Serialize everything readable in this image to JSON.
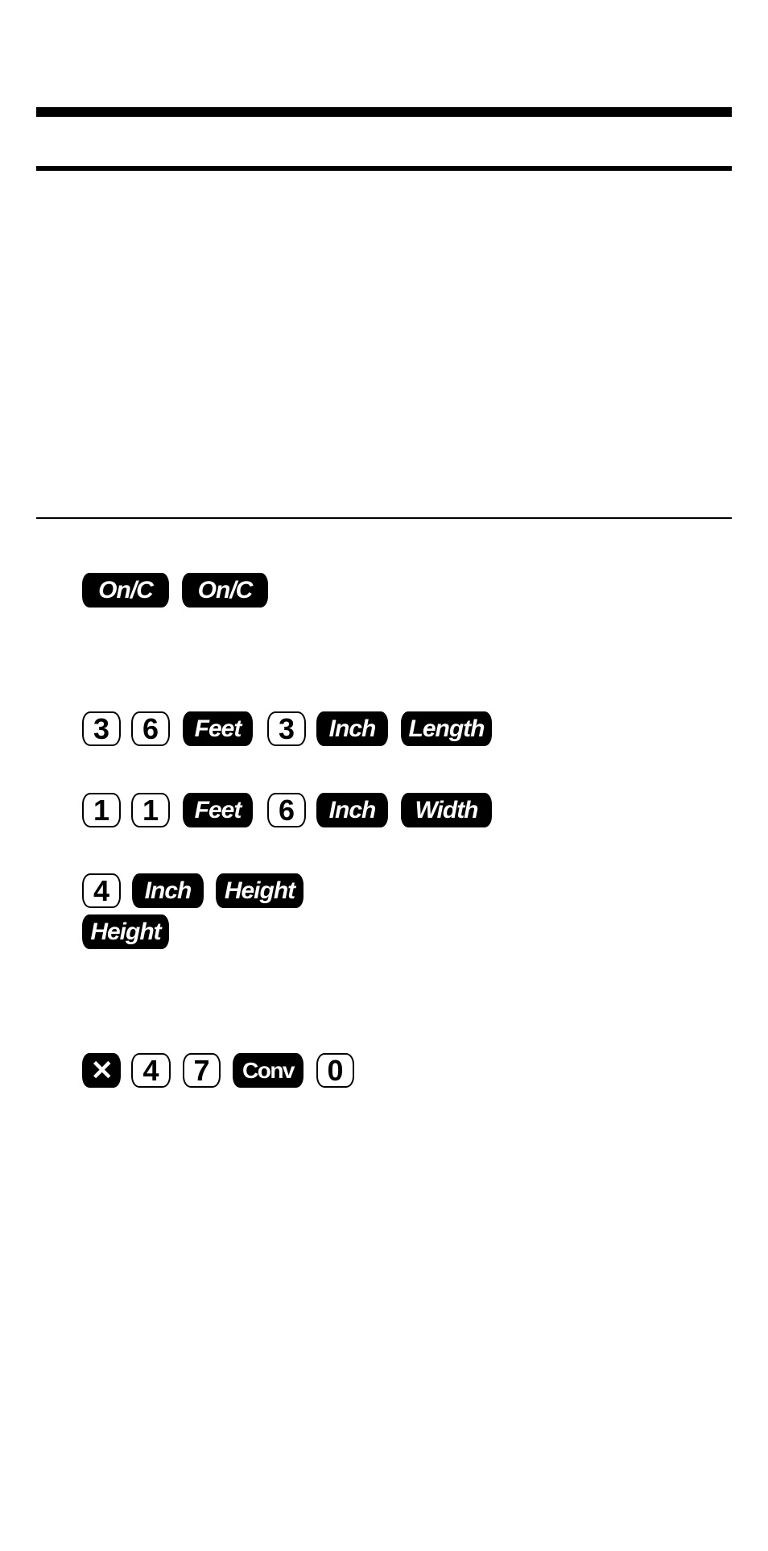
{
  "page": {
    "background": "#ffffff",
    "ink": "#000000"
  },
  "sequences": [
    {
      "keys": [
        "On/C",
        "On/C"
      ]
    },
    {
      "keys": [
        "3",
        "6",
        "Feet",
        "3",
        "Inch",
        "Length"
      ]
    },
    {
      "keys": [
        "1",
        "1",
        "Feet",
        "6",
        "Inch",
        "Width"
      ]
    },
    {
      "keys": [
        "4",
        "Inch",
        "Height"
      ]
    },
    {
      "keys": [
        "Height"
      ]
    },
    {
      "keys": [
        "✕",
        "4",
        "7",
        "Conv",
        "0"
      ]
    }
  ]
}
